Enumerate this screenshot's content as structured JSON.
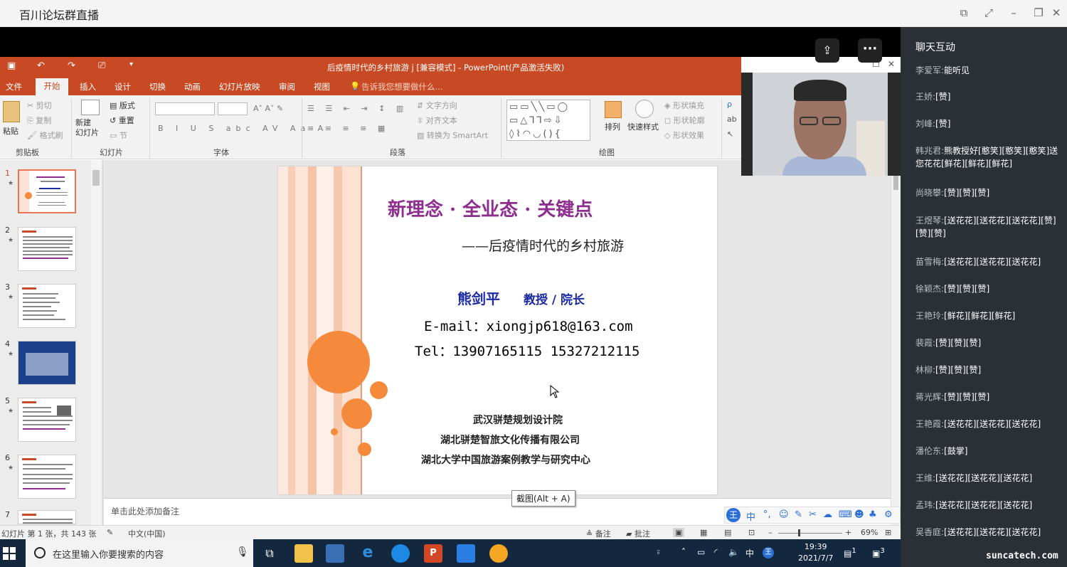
{
  "window": {
    "title": "百川论坛群直播"
  },
  "ppt": {
    "title": "后疫情时代的乡村旅游 j [兼容模式] - PowerPoint(产品激活失败)",
    "tabs": [
      "文件",
      "开始",
      "插入",
      "设计",
      "切换",
      "动画",
      "幻灯片放映",
      "审阅",
      "视图"
    ],
    "tell_me": "告诉我您想要做什么...",
    "ribbon": {
      "paste": "粘贴",
      "cut": "剪切",
      "copy": "复制",
      "format_painter": "格式刷",
      "clipboard": "剪贴板",
      "new_slide": "新建\n幻灯片",
      "layout": "版式",
      "reset": "重置",
      "section": "节",
      "slides": "幻灯片",
      "font": "字体",
      "paragraph": "段落",
      "text_direction": "文字方向",
      "align_text": "对齐文本",
      "smartart": "转换为 SmartArt",
      "arrange": "排列",
      "quick_styles": "快速样式",
      "shape_fill": "形状填充",
      "shape_outline": "形状轮廓",
      "shape_effects": "形状效果",
      "drawing": "绘图"
    },
    "slide_numbers": [
      "1",
      "2",
      "3",
      "4",
      "5",
      "6",
      "7"
    ],
    "notes_placeholder": "单击此处添加备注",
    "status": {
      "slide_info": "幻灯片 第 1 张，共 143 张",
      "language": "中文(中国)",
      "notes": "备注",
      "comments": "批注",
      "zoom": "69%"
    }
  },
  "slide": {
    "title": "新理念 · 全业态 · 关键点",
    "subtitle": "——后疫情时代的乡村旅游",
    "name": "熊剑平",
    "role": "教授 / 院长",
    "email": "E-mail：xiongjp618@163.com",
    "tel": "Tel：13907165115  15327212115",
    "org1": "武汉骈楚规划设计院",
    "org2": "湖北骈楚智旅文化传播有限公司",
    "org3": "湖北大学中国旅游案例教学与研究中心"
  },
  "tooltip": "截图(Alt + A)",
  "ime": {
    "logo": "王",
    "mode": "中"
  },
  "taskbar": {
    "search_placeholder": "在这里输入你要搜索的内容",
    "time": "19:39",
    "date": "2021/7/7",
    "ime_lang": "中",
    "ime_logo": "王",
    "notif_count": "1",
    "badge_count": "3"
  },
  "chat": {
    "title": "聊天互动",
    "messages": [
      {
        "name": "李爱军:",
        "text": "能听见"
      },
      {
        "name": "王娇:",
        "text": "[赞]"
      },
      {
        "name": "刘峰:",
        "text": "[赞]"
      },
      {
        "name": "韩兆君:",
        "text": "熊教授好[憨笑][憨笑][憨笑]送您花花[鲜花][鲜花][鲜花]"
      },
      {
        "name": "尚晓攀:",
        "text": "[赞][赞][赞]"
      },
      {
        "name": "王煜琴:",
        "text": "[送花花][送花花][送花花][赞][赞][赞]"
      },
      {
        "name": "苗雪梅:",
        "text": "[送花花][送花花][送花花]"
      },
      {
        "name": "徐颖杰:",
        "text": "[赞][赞][赞]"
      },
      {
        "name": "王艳玲:",
        "text": "[鲜花][鲜花][鲜花]"
      },
      {
        "name": "裴霞:",
        "text": "[赞][赞][赞]"
      },
      {
        "name": "林柳:",
        "text": "[赞][赞][赞]"
      },
      {
        "name": "蒋光辉:",
        "text": "[赞][赞][赞]"
      },
      {
        "name": "王艳霞:",
        "text": "[送花花][送花花][送花花]"
      },
      {
        "name": "潘伦东:",
        "text": "[鼓掌]"
      },
      {
        "name": "王维:",
        "text": "[送花花][送花花][送花花]"
      },
      {
        "name": "孟玮:",
        "text": "[送花花][送花花][送花花]"
      },
      {
        "name": "吴香庭:",
        "text": "[送花花][送花花][送花花]"
      }
    ]
  },
  "watermark": "suncatech.com"
}
